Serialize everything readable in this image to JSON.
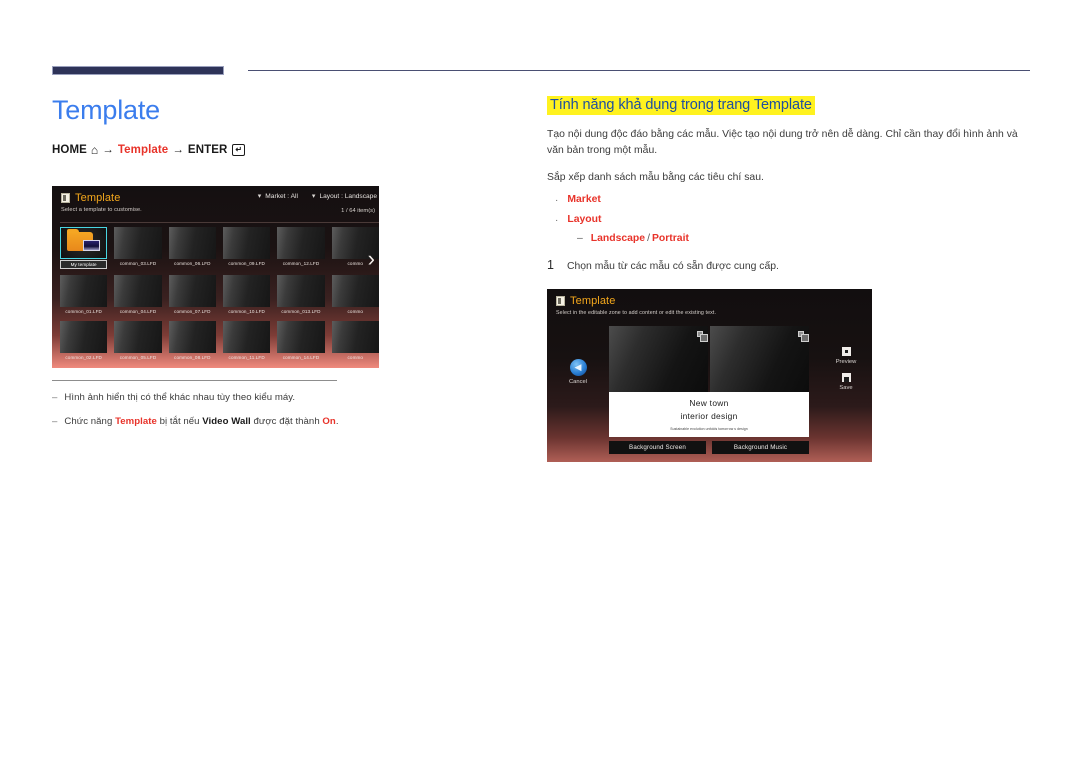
{
  "header": {
    "rule": "decorative-top-rule"
  },
  "left": {
    "title": "Template",
    "path": {
      "home": "HOME",
      "home_icon": "home-icon",
      "arrow1": "→",
      "keyword": "Template",
      "arrow2": "→",
      "enter": "ENTER",
      "enter_icon": "enter-key-icon"
    },
    "notes": [
      {
        "dash": "–",
        "segments": [
          {
            "text": "Hình ảnh hiển thị có thể khác nhau tùy theo kiểu máy.",
            "style": "plain"
          }
        ]
      },
      {
        "dash": "–",
        "segments": [
          {
            "text": "Chức năng ",
            "style": "plain"
          },
          {
            "text": "Template",
            "style": "red"
          },
          {
            "text": " bị tắt nếu ",
            "style": "plain"
          },
          {
            "text": "Video Wall",
            "style": "bold"
          },
          {
            "text": " được đặt thành ",
            "style": "plain"
          },
          {
            "text": "On",
            "style": "red"
          },
          {
            "text": ".",
            "style": "plain"
          }
        ]
      }
    ]
  },
  "shot1": {
    "app_icon": "template-app-icon",
    "title": "Template",
    "subtitle": "Select a template to customise.",
    "controls": [
      {
        "icon": "chevron-down-icon",
        "label": "Market : All"
      },
      {
        "icon": "chevron-down-icon",
        "label": "Layout : Landscape"
      }
    ],
    "count": "1 / 64 item(s)",
    "next_icon": "chevron-right-icon",
    "grid": [
      [
        {
          "label": "My template",
          "selected": true,
          "icon": "folder-icon"
        },
        {
          "label": "common_03.LFD",
          "selected": false
        },
        {
          "label": "common_06.LFD",
          "selected": false
        },
        {
          "label": "common_09.LFD",
          "selected": false
        },
        {
          "label": "common_12.LFD",
          "selected": false
        },
        {
          "label": "commo",
          "selected": false
        }
      ],
      [
        {
          "label": "common_01.LFD",
          "selected": false
        },
        {
          "label": "common_04.LFD",
          "selected": false
        },
        {
          "label": "common_07.LFD",
          "selected": false
        },
        {
          "label": "common_10.LFD",
          "selected": false
        },
        {
          "label": "common_013.LFD",
          "selected": false
        },
        {
          "label": "commo",
          "selected": false
        }
      ],
      [
        {
          "label": "common_02.LFD",
          "selected": false
        },
        {
          "label": "common_05.LFD",
          "selected": false
        },
        {
          "label": "common_08.LFD",
          "selected": false
        },
        {
          "label": "common_11.LFD",
          "selected": false
        },
        {
          "label": "common_14.LFD",
          "selected": false
        },
        {
          "label": "commo",
          "selected": false
        }
      ]
    ]
  },
  "right": {
    "section_title": "Tính năng khả dụng trong trang Template",
    "para1": "Tạo nội dung độc đáo bằng các mẫu. Việc tạo nội dung trở nên dễ dàng. Chỉ cần thay đổi hình ảnh và văn bản trong một mẫu.",
    "para2": "Sắp xếp danh sách mẫu bằng các tiêu chí sau.",
    "bullets": [
      {
        "dot": "·",
        "label": "Market"
      },
      {
        "dot": "·",
        "label": "Layout"
      }
    ],
    "sub_item": {
      "dash": "–",
      "first": "Landscape",
      "slash": "/",
      "second": "Portrait"
    },
    "step": {
      "num": "1",
      "text": "Chọn mẫu từ các mẫu có sẵn được cung cấp."
    }
  },
  "shot2": {
    "app_icon": "template-app-icon",
    "title": "Template",
    "subtitle": "Select in the editable zone to add content or edit the existing text.",
    "zone_icon": "image-placeholder-icon",
    "text_zone": {
      "line1": "New town",
      "line2": "interior design",
      "line3": "Sustainable evolution unfolds tomorrow s design"
    },
    "buttons": [
      {
        "label": "Background Screen"
      },
      {
        "label": "Background Music"
      }
    ],
    "cancel": {
      "icon": "back-arrow-icon",
      "label": "Cancel"
    },
    "preview": {
      "icon": "preview-icon",
      "label": "Preview"
    },
    "save": {
      "icon": "save-icon",
      "label": "Save"
    }
  },
  "colors": {
    "title_blue": "#3b7ded",
    "accent_red": "#e8332a",
    "highlight_yellow": "#fff21f",
    "section_blue": "#1e4fa0",
    "ui_orange": "#f3a71c",
    "selection_cyan": "#49d6e2",
    "rule_navy": "#2e3358"
  }
}
